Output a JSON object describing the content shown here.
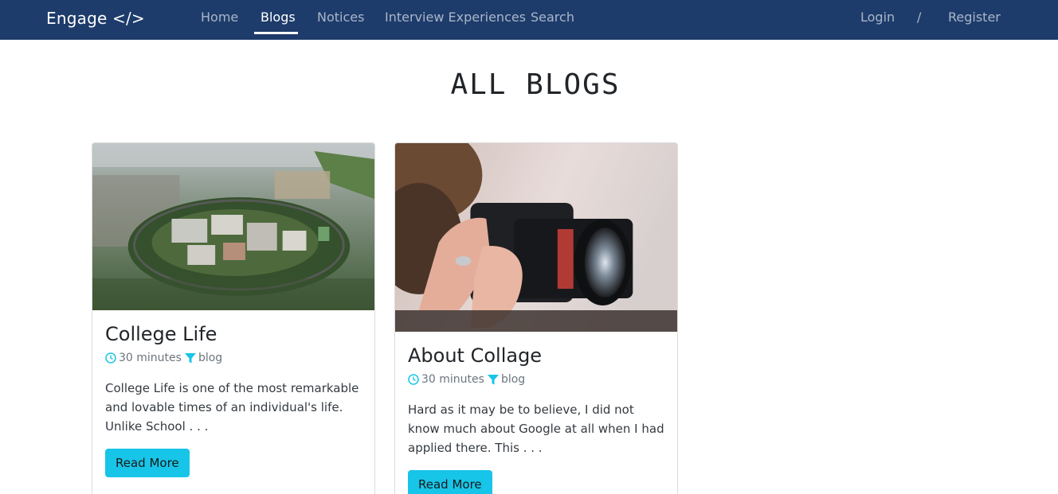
{
  "navbar": {
    "brand": "Engage </>",
    "links": [
      {
        "label": "Home"
      },
      {
        "label": "Blogs"
      },
      {
        "label": "Notices"
      },
      {
        "label": "Interview Experiences"
      },
      {
        "label": "Search"
      }
    ],
    "active": "Blogs",
    "auth": {
      "login": "Login",
      "separator": "/",
      "register": "Register"
    }
  },
  "page": {
    "title": "ALL BLOGS"
  },
  "cards": [
    {
      "title": "College Life",
      "duration": "30 minutes",
      "category": "blog",
      "excerpt": "College Life is one of the most remarkable and lovable times of an individual's life. Unlike School . . .",
      "button": "Read More"
    },
    {
      "title": "About Collage",
      "duration": "30 minutes",
      "category": "blog",
      "excerpt": "Hard as it may be to believe, I did not know much about Google at all when I had applied there. This . . .",
      "button": "Read More"
    }
  ],
  "colors": {
    "navbar": "#1e3c6b",
    "accent": "#17c5e8"
  }
}
